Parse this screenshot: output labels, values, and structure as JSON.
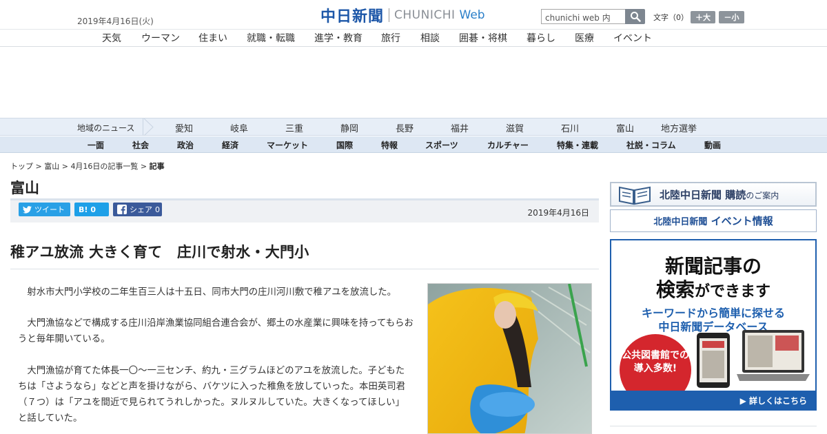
{
  "header": {
    "date": "2019年4月16日(火)",
    "logo_main": "中日新聞",
    "logo_en": "CHUNICHI",
    "logo_web": "Web",
    "search_value": "chunichi web 内",
    "font_label": "文字（0）",
    "font_bigger": "＋大",
    "font_smaller": "－小"
  },
  "categories": [
    "天気",
    "ウーマン",
    "住まい",
    "就職・転職",
    "進学・教育",
    "旅行",
    "相談",
    "囲碁・将棋",
    "暮らし",
    "医療",
    "イベント"
  ],
  "region_nav": {
    "label": "地域のニュース",
    "items": [
      "愛知",
      "岐阜",
      "三重",
      "静岡",
      "長野",
      "福井",
      "滋賀",
      "石川",
      "富山",
      "地方選挙"
    ]
  },
  "sections": [
    "一面",
    "社会",
    "政治",
    "経済",
    "マーケット",
    "国際",
    "特報",
    "スポーツ",
    "カルチャー",
    "特集・連載",
    "社説・コラム",
    "動画"
  ],
  "breadcrumb": {
    "top": "トップ",
    "region": "富山",
    "list": "4月16日の記事一覧",
    "current": "記事",
    "sep": " > "
  },
  "page_region": "富山",
  "share": {
    "tweet": "ツイート",
    "hatena_count": "0",
    "fb_label": "シェア",
    "fb_count": "0"
  },
  "article": {
    "date": "2019年4月16日",
    "headline": "稚アユ放流 大きく育て　庄川で射水・大門小",
    "paragraphs": [
      "射水市大門小学校の二年生百三人は十五日、同市大門の庄川河川敷で稚アユを放流した。",
      "大門漁協などで構成する庄川沿岸漁業協同組合連合会が、郷土の水産業に興味を持ってもらおうと毎年開いている。",
      "大門漁協が育てた体長一〇～一三センチ、約九・三グラムほどのアユを放流した。子どもたちは「さようなら」などと声を掛けながら、バケツに入った稚魚を放していった。本田英司君（７つ）は「アユを間近で見られてうれしかった。ヌルヌルしていた。大きくなってほしい」と話していた。"
    ]
  },
  "sidebar": {
    "subscribe_title": "北陸中日新聞 購読",
    "subscribe_suffix": "のご案内",
    "event_prefix": "北陸中日新聞",
    "event_title": "イベント情報",
    "db_line1": "新聞記事の",
    "db_line2a": "検索",
    "db_line2b": "ができます",
    "db_line3": "キーワードから簡単に探せる",
    "db_line4": "中日新聞データベース",
    "db_circle": "公共図書館での導入多数!",
    "db_link": "▶ 詳しくはこちら"
  },
  "colors": {
    "brand_blue": "#1d57a8",
    "twitter": "#29a0e6",
    "hatena": "#1ea0e8",
    "facebook": "#3b5a9a",
    "db_red": "#d4262d"
  }
}
